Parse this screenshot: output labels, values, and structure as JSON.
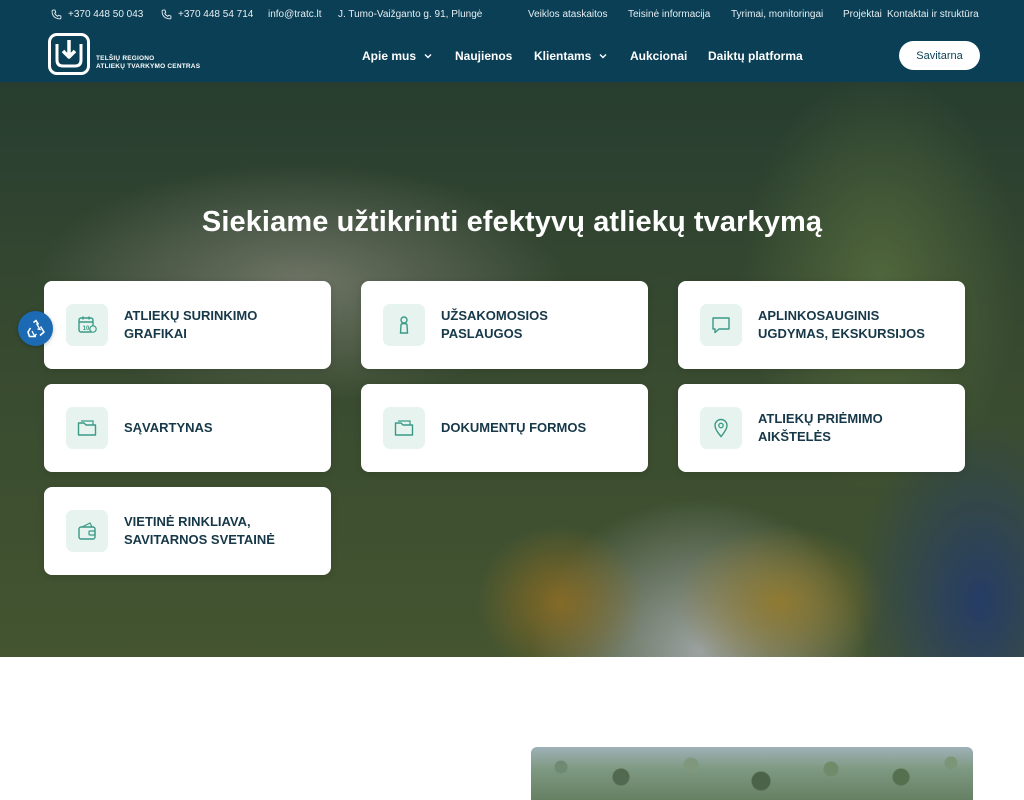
{
  "topbar": {
    "phone1": "+370 448 50 043",
    "phone2": "+370 448 54 714",
    "email": "info@tratc.lt",
    "address": "J. Tumo-Vaižganto g. 91, Plungė",
    "links": [
      "Veiklos ataskaitos",
      "Teisinė informacija",
      "Tyrimai, monitoringai",
      "Projektai",
      "Kontaktai ir struktūra"
    ]
  },
  "logo": {
    "line1": "TELŠIŲ REGIONO",
    "line2": "ATLIEKŲ TVARKYMO CENTRAS"
  },
  "nav": {
    "items": [
      {
        "label": "Apie mus",
        "has_dropdown": true
      },
      {
        "label": "Naujienos",
        "has_dropdown": false
      },
      {
        "label": "Klientams",
        "has_dropdown": true
      },
      {
        "label": "Aukcionai",
        "has_dropdown": false
      },
      {
        "label": "Daiktų platforma",
        "has_dropdown": false
      }
    ],
    "cta_label": "Savitarna"
  },
  "hero": {
    "title": "Siekiame užtikrinti efektyvų atliekų tvarkymą"
  },
  "cards": [
    {
      "line1": "ATLIEKŲ SURINKIMO",
      "line2": "GRAFIKAI",
      "icon": "calendar-icon"
    },
    {
      "line1": "UŽSAKOMOSIOS",
      "line2": "PASLAUGOS",
      "icon": "person-icon"
    },
    {
      "line1": "APLINKOSAUGINIS",
      "line2": "UGDYMAS, EKSKURSIJOS",
      "icon": "chat-icon"
    },
    {
      "line1": "SĄVARTYNAS",
      "line2": "",
      "icon": "folder-icon"
    },
    {
      "line1": "DOKUMENTŲ FORMOS",
      "line2": "",
      "icon": "folder-icon"
    },
    {
      "line1": "ATLIEKŲ PRIĖMIMO",
      "line2": "AIKŠTELĖS",
      "icon": "location-pin-icon"
    },
    {
      "line1": "VIETINĖ RINKLIAVA,",
      "line2": "SAVITARNOS SVETAINĖ",
      "icon": "wallet-icon"
    }
  ],
  "colors": {
    "header_bg": "#0a3f55",
    "card_icon_bg": "#e6f3ef",
    "icon_stroke": "#3a9a86",
    "card_text": "#163848",
    "fab_bg": "#1c6ab3"
  }
}
